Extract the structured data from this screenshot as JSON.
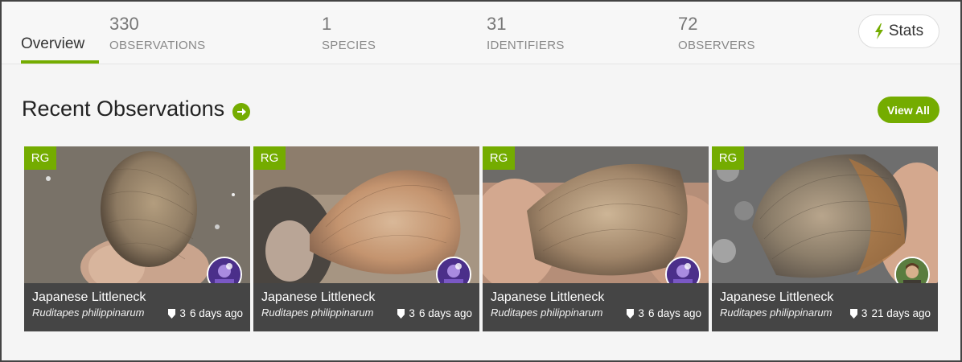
{
  "tabs": {
    "overview": "Overview"
  },
  "stats": [
    {
      "value": "330",
      "label": "OBSERVATIONS"
    },
    {
      "value": "1",
      "label": "SPECIES"
    },
    {
      "value": "31",
      "label": "IDENTIFIERS"
    },
    {
      "value": "72",
      "label": "OBSERVERS"
    }
  ],
  "stats_button": {
    "label": "Stats",
    "icon": "lightning-bolt-icon"
  },
  "recent": {
    "title": "Recent Observations",
    "view_all": "View All"
  },
  "observations": [
    {
      "badge": "RG",
      "common_name": "Japanese Littleneck",
      "scientific_name": "Ruditapes philippinarum",
      "ids": "3",
      "time": "6 days ago"
    },
    {
      "badge": "RG",
      "common_name": "Japanese Littleneck",
      "scientific_name": "Ruditapes philippinarum",
      "ids": "3",
      "time": "6 days ago"
    },
    {
      "badge": "RG",
      "common_name": "Japanese Littleneck",
      "scientific_name": "Ruditapes philippinarum",
      "ids": "3",
      "time": "6 days ago"
    },
    {
      "badge": "RG",
      "common_name": "Japanese Littleneck",
      "scientific_name": "Ruditapes philippinarum",
      "ids": "3",
      "time": "21 days ago"
    }
  ],
  "colors": {
    "accent": "#74ac00",
    "caption_bg": "#454545"
  }
}
